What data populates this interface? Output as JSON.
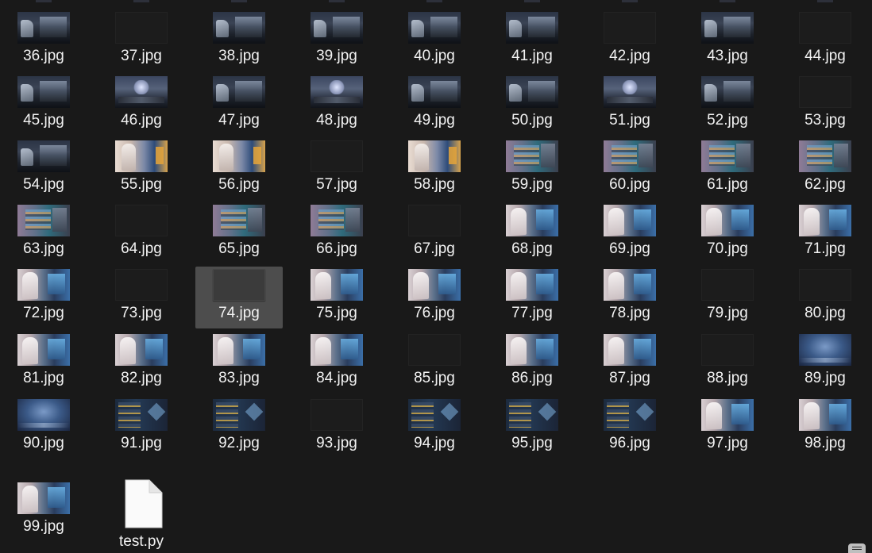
{
  "window": {
    "view_mode": "large-icons",
    "selected_file": "74.jpg"
  },
  "files": [
    {
      "name": "36.jpg",
      "thumb": "a"
    },
    {
      "name": "37.jpg",
      "thumb": "blank"
    },
    {
      "name": "38.jpg",
      "thumb": "a"
    },
    {
      "name": "39.jpg",
      "thumb": "a"
    },
    {
      "name": "40.jpg",
      "thumb": "a"
    },
    {
      "name": "41.jpg",
      "thumb": "a"
    },
    {
      "name": "42.jpg",
      "thumb": "blank"
    },
    {
      "name": "43.jpg",
      "thumb": "a"
    },
    {
      "name": "44.jpg",
      "thumb": "blank"
    },
    {
      "name": "45.jpg",
      "thumb": "a"
    },
    {
      "name": "46.jpg",
      "thumb": "b"
    },
    {
      "name": "47.jpg",
      "thumb": "a"
    },
    {
      "name": "48.jpg",
      "thumb": "b"
    },
    {
      "name": "49.jpg",
      "thumb": "a"
    },
    {
      "name": "50.jpg",
      "thumb": "a"
    },
    {
      "name": "51.jpg",
      "thumb": "b"
    },
    {
      "name": "52.jpg",
      "thumb": "a"
    },
    {
      "name": "53.jpg",
      "thumb": "blank"
    },
    {
      "name": "54.jpg",
      "thumb": "a"
    },
    {
      "name": "55.jpg",
      "thumb": "c"
    },
    {
      "name": "56.jpg",
      "thumb": "c"
    },
    {
      "name": "57.jpg",
      "thumb": "blank"
    },
    {
      "name": "58.jpg",
      "thumb": "c"
    },
    {
      "name": "59.jpg",
      "thumb": "d"
    },
    {
      "name": "60.jpg",
      "thumb": "d"
    },
    {
      "name": "61.jpg",
      "thumb": "d"
    },
    {
      "name": "62.jpg",
      "thumb": "d"
    },
    {
      "name": "63.jpg",
      "thumb": "d"
    },
    {
      "name": "64.jpg",
      "thumb": "blank"
    },
    {
      "name": "65.jpg",
      "thumb": "d"
    },
    {
      "name": "66.jpg",
      "thumb": "d"
    },
    {
      "name": "67.jpg",
      "thumb": "blank"
    },
    {
      "name": "68.jpg",
      "thumb": "e"
    },
    {
      "name": "69.jpg",
      "thumb": "e"
    },
    {
      "name": "70.jpg",
      "thumb": "e"
    },
    {
      "name": "71.jpg",
      "thumb": "e"
    },
    {
      "name": "72.jpg",
      "thumb": "e"
    },
    {
      "name": "73.jpg",
      "thumb": "blank"
    },
    {
      "name": "74.jpg",
      "thumb": "blank",
      "selected": true
    },
    {
      "name": "75.jpg",
      "thumb": "e"
    },
    {
      "name": "76.jpg",
      "thumb": "e"
    },
    {
      "name": "77.jpg",
      "thumb": "e"
    },
    {
      "name": "78.jpg",
      "thumb": "e"
    },
    {
      "name": "79.jpg",
      "thumb": "blank"
    },
    {
      "name": "80.jpg",
      "thumb": "blank"
    },
    {
      "name": "81.jpg",
      "thumb": "e"
    },
    {
      "name": "82.jpg",
      "thumb": "e"
    },
    {
      "name": "83.jpg",
      "thumb": "e"
    },
    {
      "name": "84.jpg",
      "thumb": "e"
    },
    {
      "name": "85.jpg",
      "thumb": "blank"
    },
    {
      "name": "86.jpg",
      "thumb": "e"
    },
    {
      "name": "87.jpg",
      "thumb": "e"
    },
    {
      "name": "88.jpg",
      "thumb": "blank"
    },
    {
      "name": "89.jpg",
      "thumb": "f"
    },
    {
      "name": "90.jpg",
      "thumb": "f"
    },
    {
      "name": "91.jpg",
      "thumb": "g"
    },
    {
      "name": "92.jpg",
      "thumb": "g"
    },
    {
      "name": "93.jpg",
      "thumb": "blank"
    },
    {
      "name": "94.jpg",
      "thumb": "g"
    },
    {
      "name": "95.jpg",
      "thumb": "g"
    },
    {
      "name": "96.jpg",
      "thumb": "g"
    },
    {
      "name": "97.jpg",
      "thumb": "e"
    },
    {
      "name": "98.jpg",
      "thumb": "e"
    },
    {
      "name": "99.jpg",
      "thumb": "e"
    },
    {
      "name": "test.py",
      "thumb": "file"
    }
  ],
  "colors": {
    "background": "#191919",
    "selection": "#4d4d4d",
    "text": "#f2f2f2"
  },
  "icons": {
    "document": "document-icon",
    "corner": "view-toggle-icon"
  }
}
